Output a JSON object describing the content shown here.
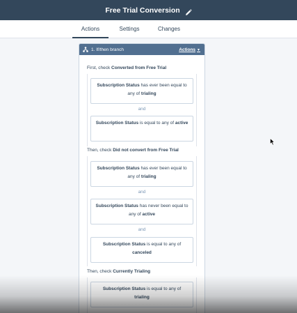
{
  "header": {
    "title": "Free Trial Conversion",
    "edit_icon": "pencil-icon"
  },
  "tabs": [
    {
      "label": "Actions",
      "active": true
    },
    {
      "label": "Settings",
      "active": false
    },
    {
      "label": "Changes",
      "active": false
    }
  ],
  "branch_card": {
    "icon": "branch-icon",
    "title": "1. If/then branch",
    "actions_label": "Actions",
    "branches": [
      {
        "prefix": "First, check",
        "name": "Converted from Free Trial",
        "conditions": [
          {
            "property": "Subscription Status",
            "operator": "has ever been equal to any of",
            "value": "trialing"
          },
          {
            "property": "Subscription Status",
            "operator": "is equal to any of",
            "value": "active"
          }
        ]
      },
      {
        "prefix": "Then, check",
        "name": "Did not convert from Free Trial",
        "conditions": [
          {
            "property": "Subscription Status",
            "operator": "has ever been equal to any of",
            "value": "trialing"
          },
          {
            "property": "Subscription Status",
            "operator": "has never been equal to any of",
            "value": "active"
          },
          {
            "property": "Subscription Status",
            "operator": "is equal to any of",
            "value": "canceled"
          }
        ]
      },
      {
        "prefix": "Then, check",
        "name": "Currently Trialing",
        "conditions": [
          {
            "property": "Subscription Status",
            "operator": "is equal to any of",
            "value": "trialing"
          }
        ]
      }
    ],
    "joiner": "and"
  },
  "colors": {
    "topbar": "#33475b",
    "card_header": "#516f90",
    "canvas": "#f4f6f9"
  }
}
